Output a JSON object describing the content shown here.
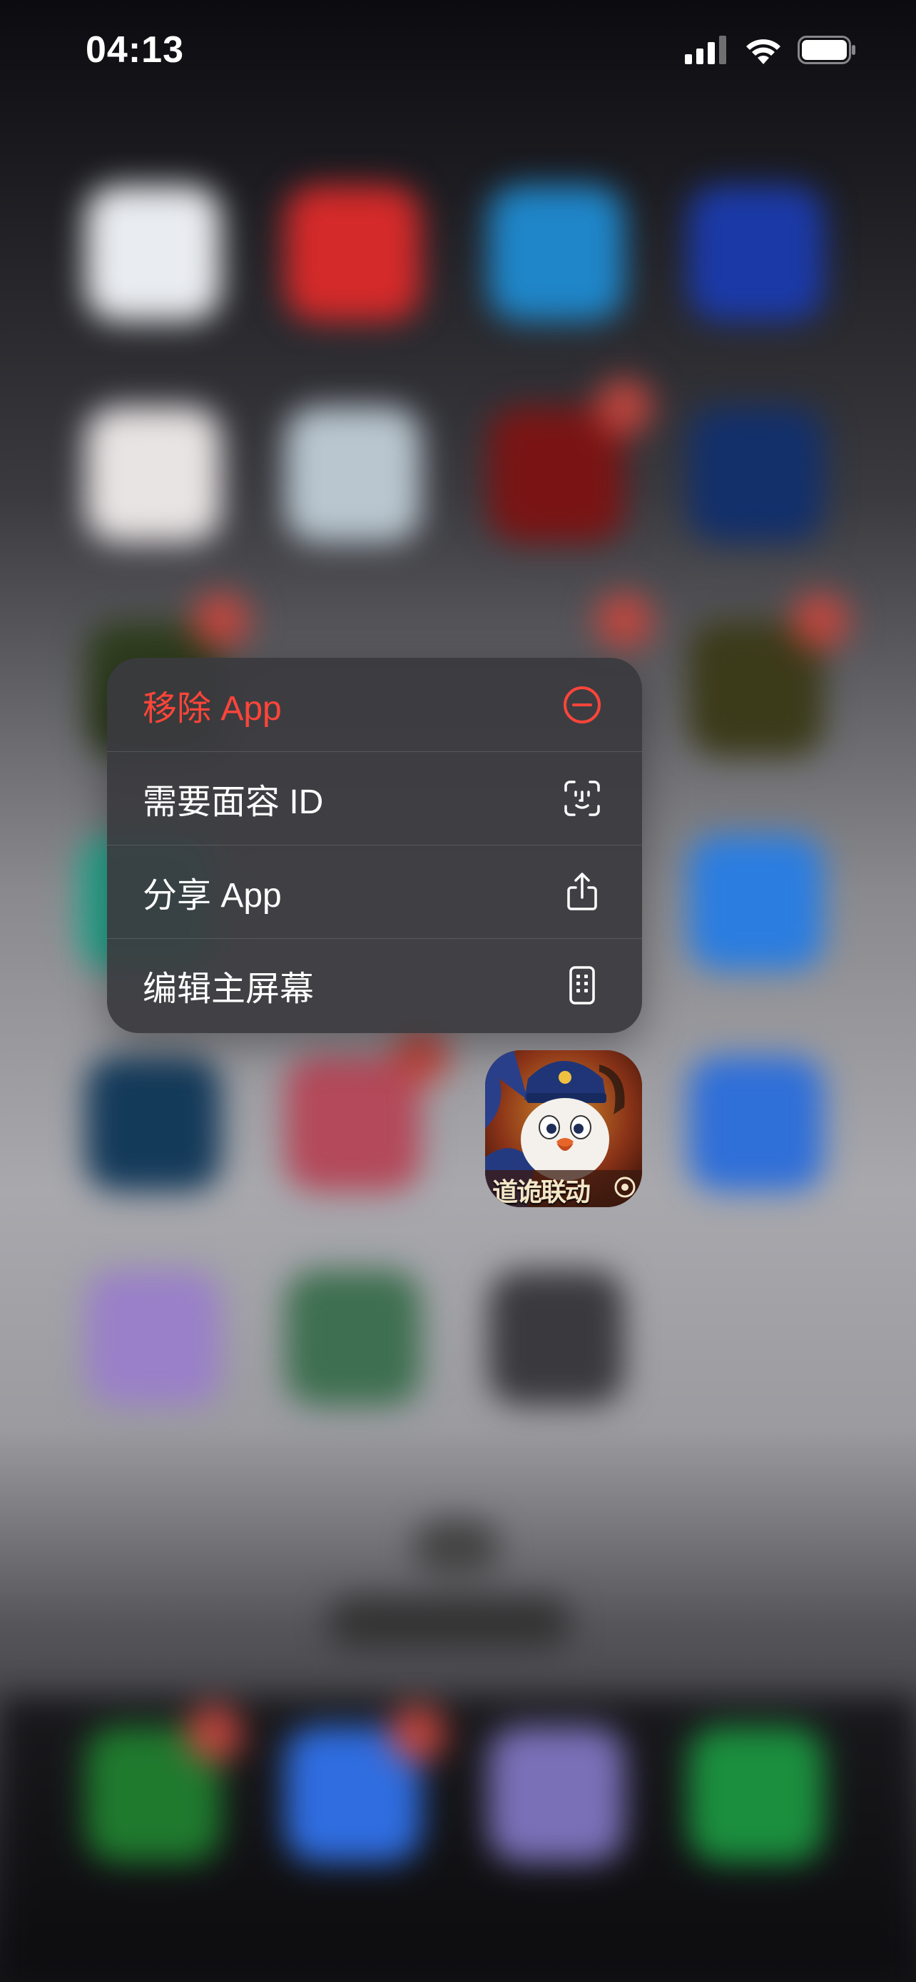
{
  "status_bar": {
    "time": "04:13",
    "icons": [
      "cellular-signal-icon",
      "wifi-icon",
      "battery-icon"
    ]
  },
  "context_menu": {
    "items": [
      {
        "label": "移除 App",
        "icon": "minus-circle-icon",
        "style": "destructive"
      },
      {
        "label": "需要面容 ID",
        "icon": "face-id-icon",
        "style": "default"
      },
      {
        "label": "分享 App",
        "icon": "share-icon",
        "style": "default"
      },
      {
        "label": "编辑主屏幕",
        "icon": "phone-grid-icon",
        "style": "default"
      }
    ]
  },
  "focused_app": {
    "icon_text": "道诡联动"
  },
  "colors": {
    "destructive": "#ff453a",
    "menu_background": "#3a3a3e",
    "menu_text": "#ffffff"
  }
}
